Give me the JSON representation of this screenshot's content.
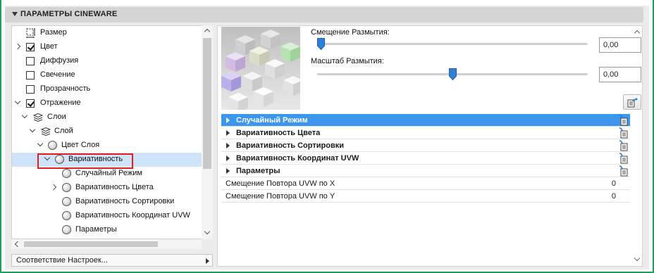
{
  "section": {
    "title": "ПАРАМЕТРЫ CINEWARE"
  },
  "tree": [
    {
      "label": "Размер"
    },
    {
      "label": "Цвет"
    },
    {
      "label": "Диффузия"
    },
    {
      "label": "Свечение"
    },
    {
      "label": "Прозрачность"
    },
    {
      "label": "Отражение"
    },
    {
      "label": "Слои"
    },
    {
      "label": "Слой"
    },
    {
      "label": "Цвет Слоя"
    },
    {
      "label": "Вариативность"
    },
    {
      "label": "Случайный Режим"
    },
    {
      "label": "Вариативность Цвета"
    },
    {
      "label": "Вариативность Сортировки"
    },
    {
      "label": "Вариативность Координат UVW"
    },
    {
      "label": "Параметры"
    }
  ],
  "dropdown": {
    "label": "Соответствие Настроек..."
  },
  "sliders": [
    {
      "label": "Смещение Размытия:",
      "value": "0,00",
      "position": 0.0
    },
    {
      "label": "Масштаб Размытия:",
      "value": "0,00",
      "position": 0.5
    }
  ],
  "properties": [
    {
      "label": "Случайный Режим",
      "value": ""
    },
    {
      "label": "Вариативность Цвета",
      "value": ""
    },
    {
      "label": "Вариативность Сортировки",
      "value": ""
    },
    {
      "label": "Вариативность Координат UVW",
      "value": ""
    },
    {
      "label": "Параметры",
      "value": ""
    },
    {
      "label": "Смещение Повтора UVW по X",
      "value": "0"
    },
    {
      "label": "Смещение Повтора UVW по Y",
      "value": "0"
    }
  ],
  "colors": {
    "selection": "#3c96ec",
    "tree_selection": "#cfe3fb",
    "slider_handle": "#2f7fd8",
    "highlight": "#e0201c"
  }
}
